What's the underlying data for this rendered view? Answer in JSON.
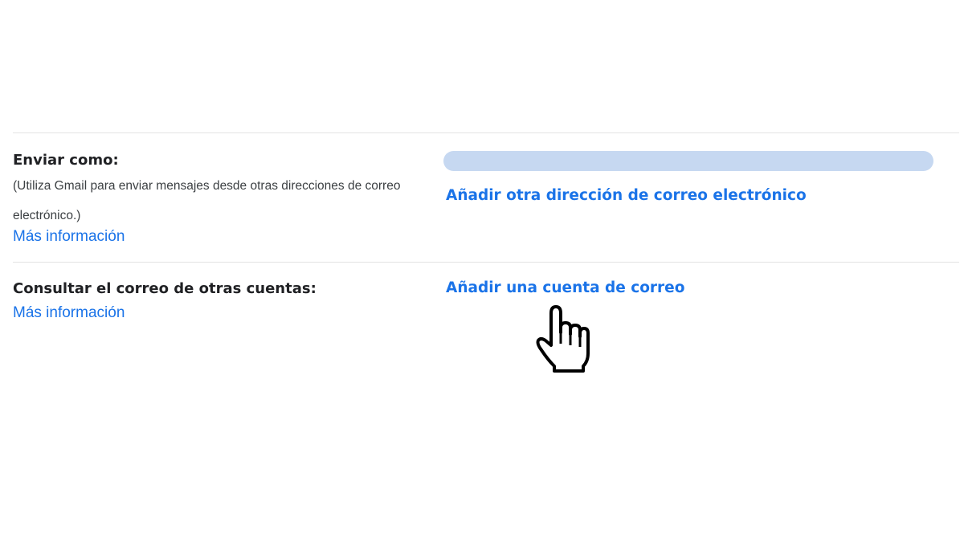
{
  "send_as": {
    "label": "Enviar como:",
    "description": "(Utiliza Gmail para enviar mensajes desde otras direcciones de correo electrónico.)",
    "learn_more": "Más información",
    "add_address_link": "Añadir otra dirección de correo electrónico"
  },
  "check_mail": {
    "label": "Consultar el correo de otras cuentas:",
    "learn_more": "Más información",
    "add_account_link": "Añadir una cuenta de correo"
  },
  "cursor": {
    "icon": "hand-pointer-icon"
  },
  "colors": {
    "link": "#1a73e8",
    "label": "#202124",
    "redacted_bar": "#c6d8f1",
    "divider": "#e3e3e3"
  }
}
